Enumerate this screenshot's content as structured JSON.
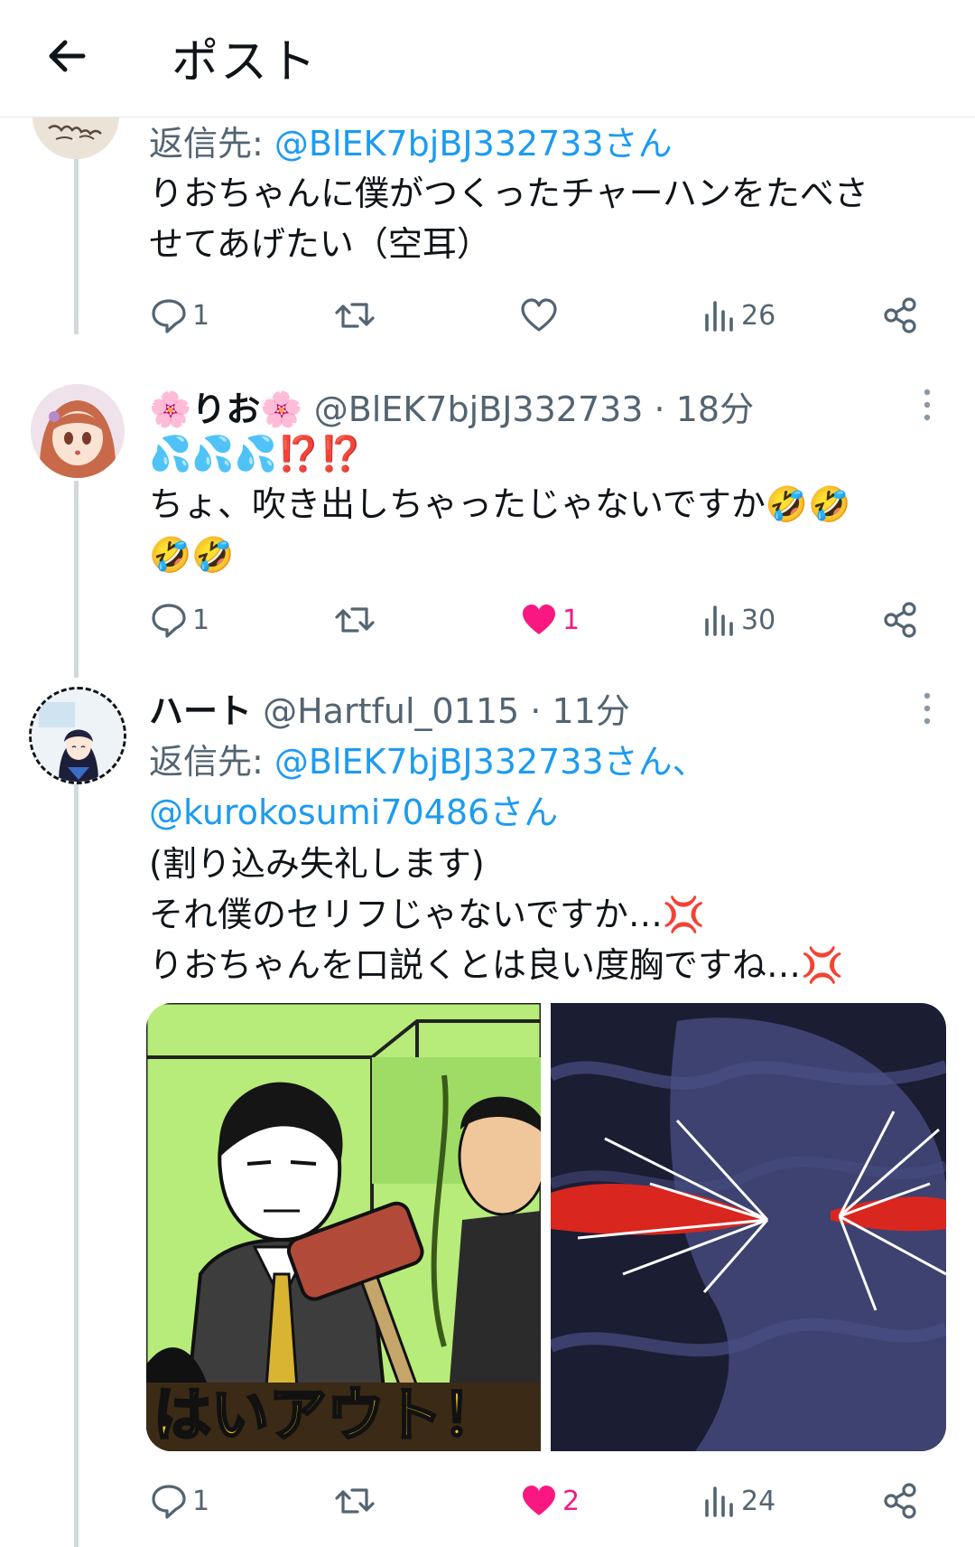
{
  "header": {
    "title": "ポスト",
    "back_icon": "arrow-left-icon"
  },
  "posts": [
    {
      "reply_label": "返信先:",
      "reply_mention": "@BlEK7bjBJ332733さん",
      "lines": [
        "りおちゃんに僕がつくったチャーハンをたべさ",
        "せてあげたい（空耳）"
      ],
      "actions": {
        "replies": "1",
        "reposts": "",
        "likes": "",
        "views": "26"
      }
    },
    {
      "display_name": "🌸りお🌸",
      "handle": "@BlEK7bjBJ332733 · 18分",
      "lines": [
        "💦💦💦⁉️⁉️",
        "ちょ、吹き出しちゃったじゃないですか🤣🤣",
        "🤣🤣"
      ],
      "actions": {
        "replies": "1",
        "reposts": "",
        "likes": "1",
        "views": "30"
      }
    },
    {
      "display_name": "ハート",
      "handle": "@Hartful_0115 · 11分",
      "reply_label": "返信先:",
      "reply_mention": "@BlEK7bjBJ332733さん、",
      "reply_mention2": "@kurokosumi70486さん",
      "lines": [
        "(割り込み失礼します)",
        "それ僕のセリフじゃないですか…💢",
        "りおちゃんを口説くとは良い度胸ですね…💢"
      ],
      "image_caption": "はいアウト！",
      "actions": {
        "replies": "1",
        "reposts": "",
        "likes": "2",
        "views": "24"
      }
    }
  ],
  "colors": {
    "text": "#0f1419",
    "secondary": "#536471",
    "link": "#1d9bf0",
    "like": "#f91880",
    "thread_line": "#cfd9de"
  }
}
